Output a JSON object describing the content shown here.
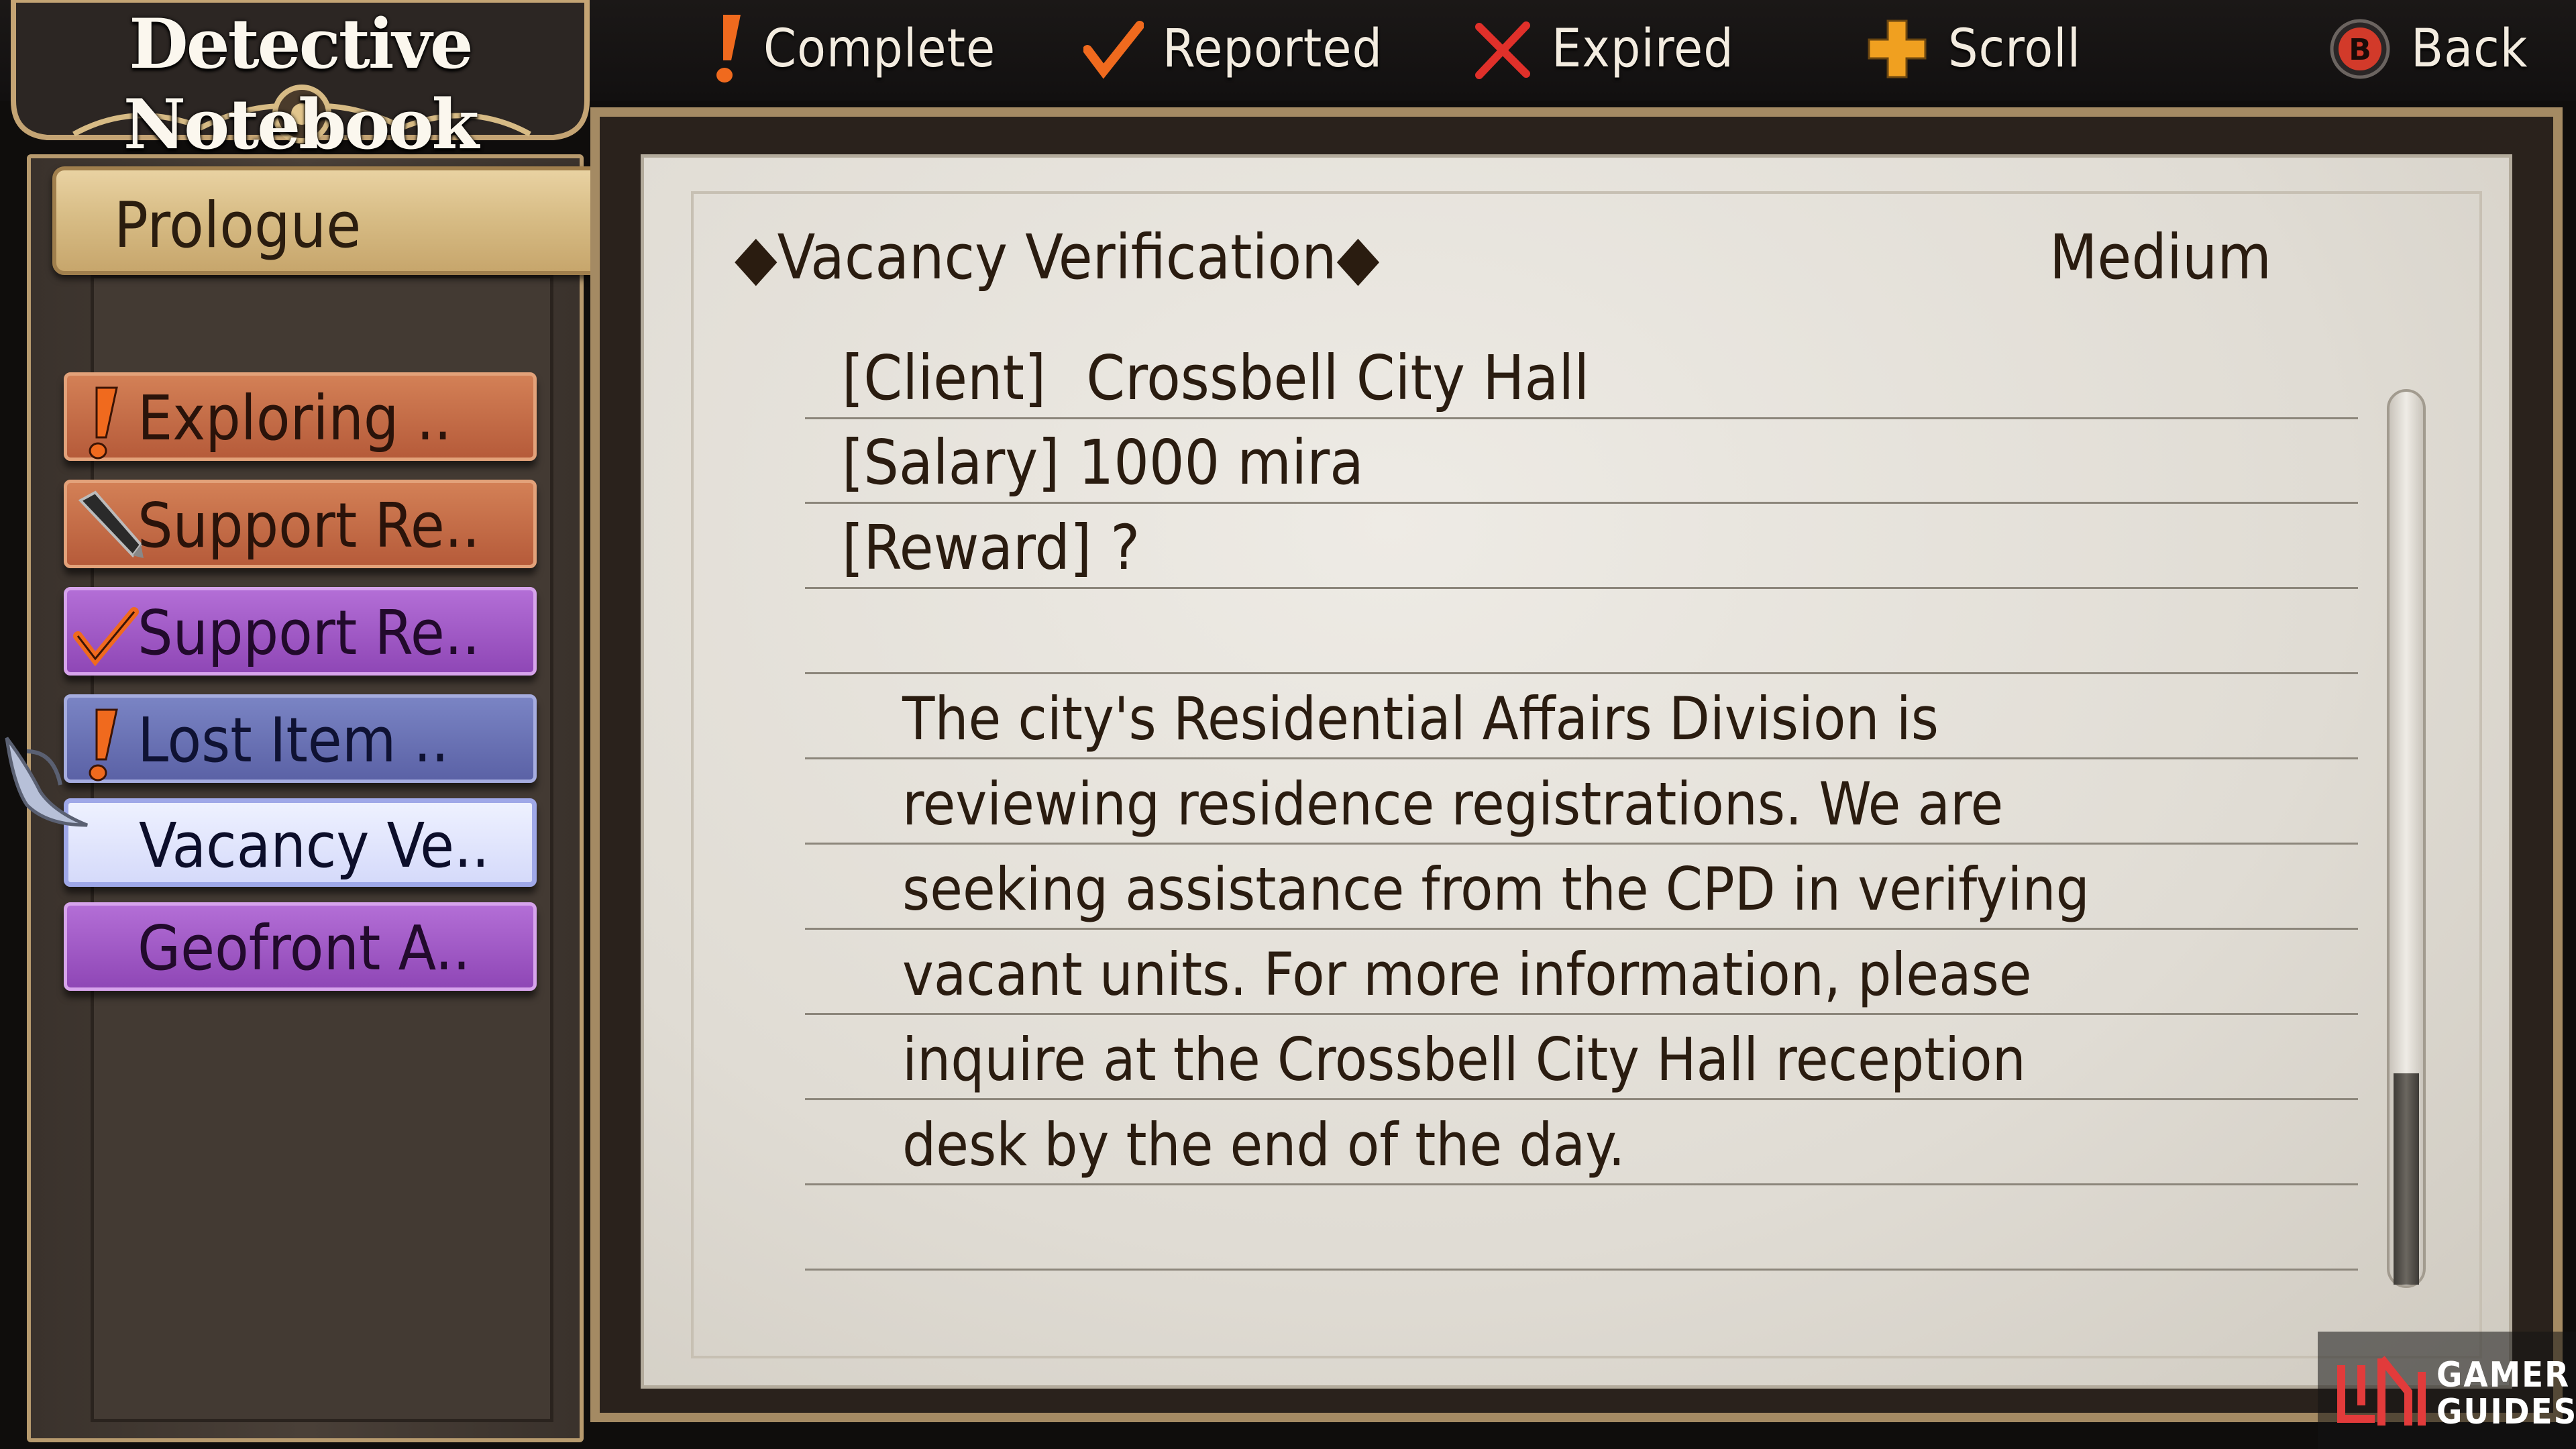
{
  "header": {
    "title": "Detective Notebook",
    "legend": [
      {
        "icon": "exclamation-icon",
        "label": "Complete",
        "color": "#f06a1e"
      },
      {
        "icon": "checkmark-icon",
        "label": "Reported",
        "color": "#f06a1e"
      },
      {
        "icon": "x-mark-icon",
        "label": "Expired",
        "color": "#e0302a"
      },
      {
        "icon": "dpad-icon",
        "label": "Scroll",
        "color": "#f0a020"
      },
      {
        "icon": "b-button-icon",
        "label": "Back",
        "button_letter": "B",
        "color": "#d23a2a"
      }
    ]
  },
  "sidebar": {
    "chapter": "Prologue",
    "quests": [
      {
        "label": "Exploring ..",
        "icon": "exclamation-icon",
        "color": "orange"
      },
      {
        "label": "Support Re..",
        "icon": "pen-icon",
        "color": "orange"
      },
      {
        "label": "Support Re..",
        "icon": "checkmark-icon",
        "color": "purple"
      },
      {
        "label": "Lost Item ..",
        "icon": "exclamation-icon",
        "color": "blue"
      },
      {
        "label": "Vacancy Ve..",
        "icon": "",
        "color": "selected"
      },
      {
        "label": "Geofront A..",
        "icon": "",
        "color": "purple"
      }
    ]
  },
  "detail": {
    "title": "◆Vacancy Verification◆",
    "rank": "Medium",
    "client_label": "[Client]",
    "client_value": "Crossbell City Hall",
    "salary_label": "[Salary]",
    "salary_value": "1000 mira",
    "reward_label": "[Reward]",
    "reward_value": "?",
    "description": [
      "The city's Residential Affairs Division is",
      "reviewing residence registrations. We are",
      "seeking assistance from the CPD in verifying",
      "vacant units. For more information, please",
      "inquire at the Crossbell City Hall reception",
      "desk by the end of the day."
    ]
  },
  "watermark": {
    "line1": "GAMER",
    "line2": "GUIDES"
  }
}
